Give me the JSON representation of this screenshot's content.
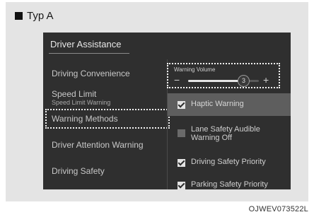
{
  "type_header": "Typ A",
  "screen": {
    "title": "Driver Assistance",
    "menu": [
      {
        "label": "Driving Convenience"
      },
      {
        "label": "Speed Limit",
        "sublabel": "Speed Limit Warning"
      },
      {
        "label": "Warning Methods"
      },
      {
        "label": "Driver Attention Warning"
      },
      {
        "label": "Driving Safety"
      }
    ],
    "volume": {
      "label": "Warning Volume",
      "minus": "−",
      "plus": "+",
      "value_text": "3",
      "fill_fraction": 0.78
    },
    "options": [
      {
        "label": "Haptic Warning",
        "checked": true,
        "selected": true
      },
      {
        "label": "Lane Safety Audible Warning Off",
        "checked": false,
        "selected": false
      },
      {
        "label": "Driving Safety Priority",
        "checked": true,
        "selected": false
      },
      {
        "label": "Parking Safety Priority",
        "checked": true,
        "selected": false
      }
    ]
  },
  "caption": "OJWEV073522L",
  "colors": {
    "screen_bg": "#2f2f2f",
    "selected_row": "#5e5e5e",
    "frame_bg": "#e4e4e4"
  }
}
